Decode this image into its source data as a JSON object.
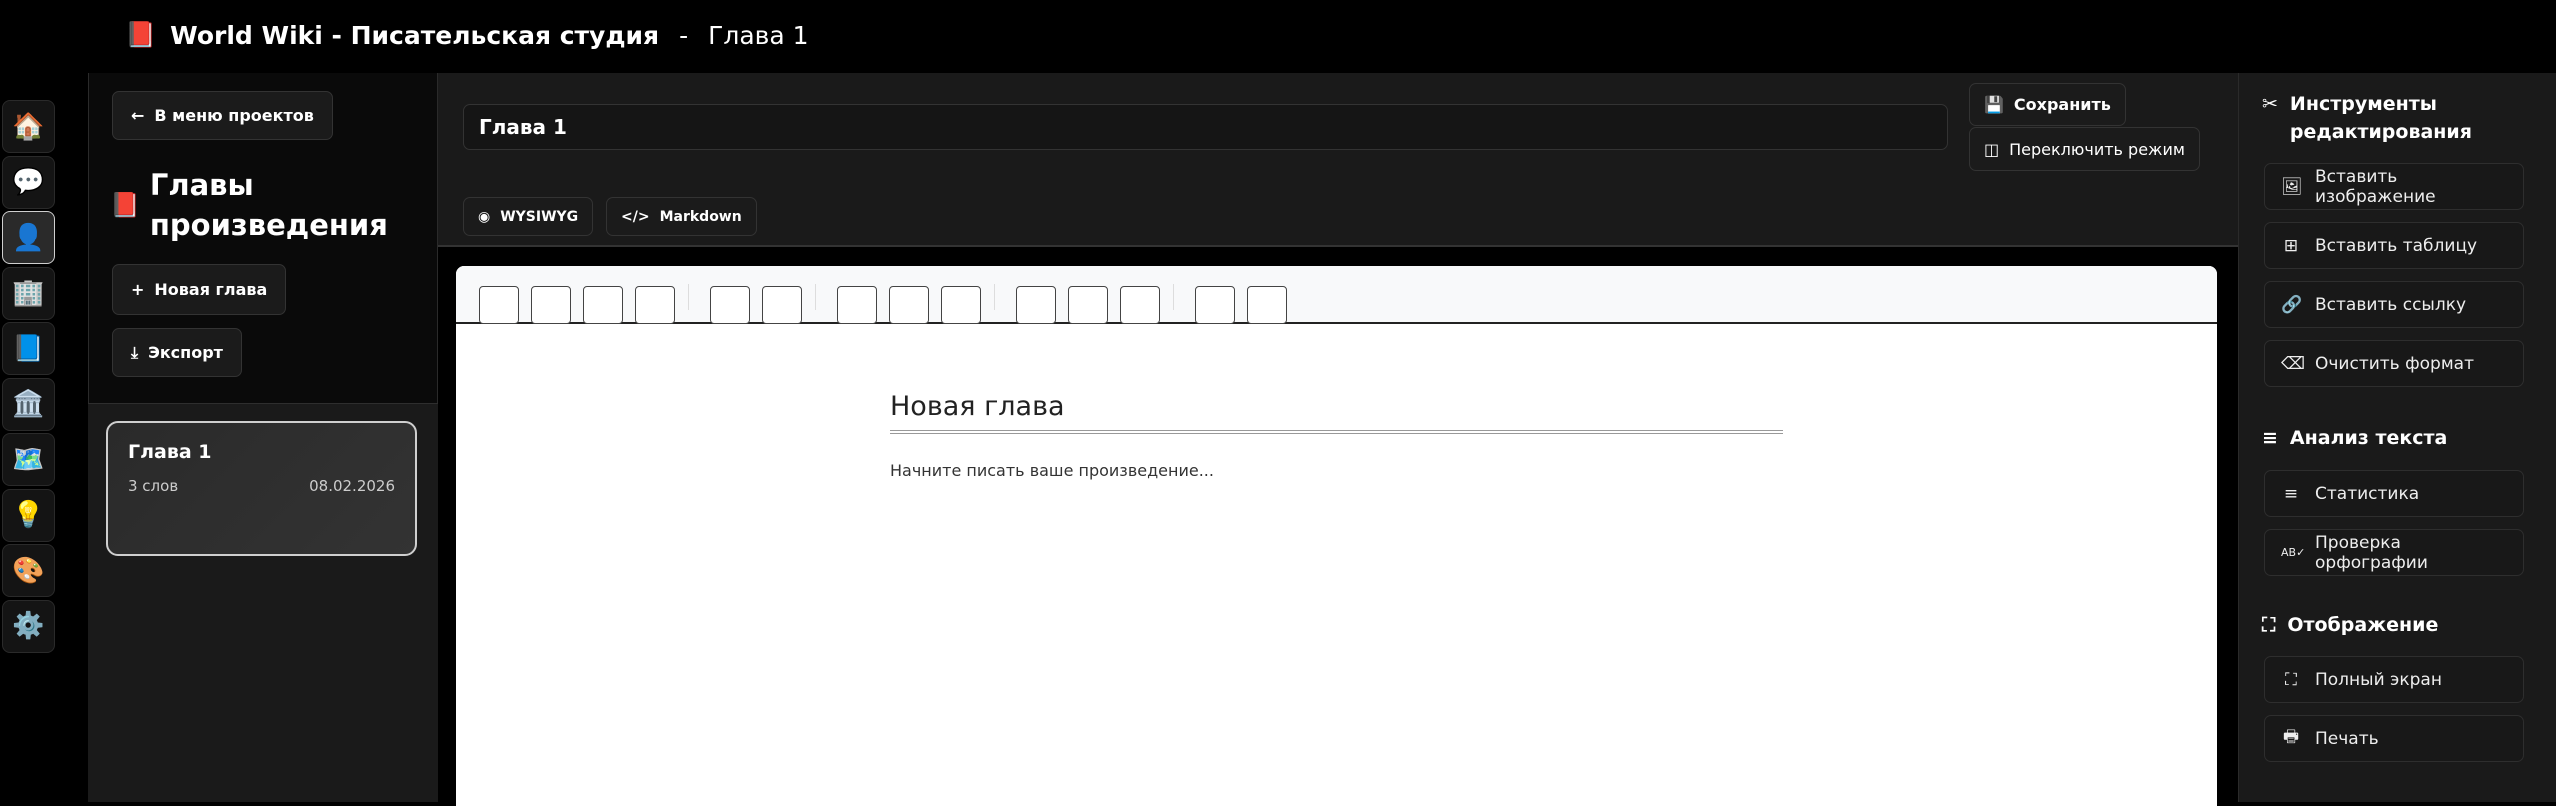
{
  "header": {
    "app_title": "World Wiki - Писательская студия",
    "separator": "-",
    "chapter": "Глава 1"
  },
  "rail": [
    {
      "name": "home",
      "glyph": "🏠"
    },
    {
      "name": "chat",
      "glyph": "💬"
    },
    {
      "name": "characters",
      "glyph": "👤"
    },
    {
      "name": "buildings",
      "glyph": "🏢"
    },
    {
      "name": "writing",
      "glyph": "📘"
    },
    {
      "name": "history",
      "glyph": "🏛️"
    },
    {
      "name": "map",
      "glyph": "🗺️"
    },
    {
      "name": "ideas",
      "glyph": "💡"
    },
    {
      "name": "palette",
      "glyph": "🎨"
    },
    {
      "name": "settings",
      "glyph": "⚙️"
    }
  ],
  "left": {
    "back_label": "В меню проектов",
    "heading": "Главы произведения",
    "new_chapter": "Новая глава",
    "export": "Экспорт",
    "chapters": [
      {
        "title": "Глава 1",
        "words": "3 слов",
        "date": "08.02.2026"
      }
    ]
  },
  "editor": {
    "title_value": "Глава 1",
    "save": "Сохранить",
    "switch_mode": "Переключить режим",
    "wysiwyg": "WYSIWYG",
    "markdown": "Markdown",
    "doc_heading": "Новая глава",
    "doc_placeholder": "Начните писать ваше произведение..."
  },
  "right": {
    "tools_heading": "Инструменты редактирования",
    "insert_image": "Вставить изображение",
    "insert_table": "Вставить таблицу",
    "insert_link": "Вставить ссылку",
    "clear_format": "Очистить формат",
    "analysis_heading": "Анализ текста",
    "stats": "Статистика",
    "spellcheck": "Проверка орфографии",
    "display_heading": "Отображение",
    "fullscreen": "Полный экран",
    "print": "Печать"
  }
}
